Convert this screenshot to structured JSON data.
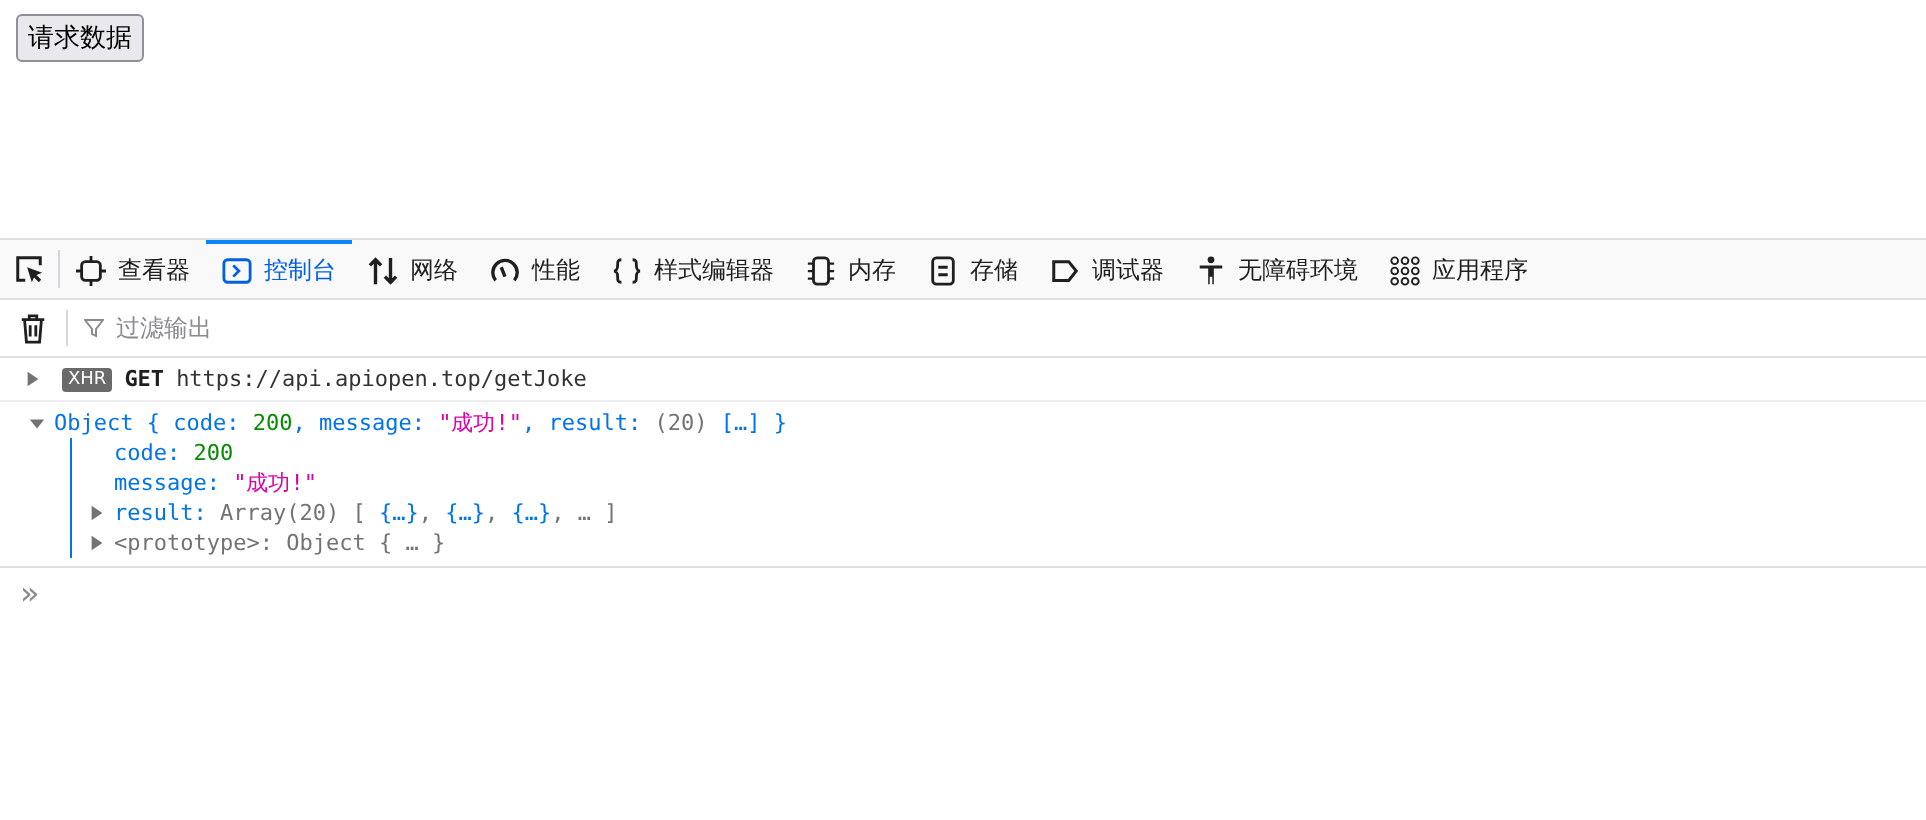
{
  "page": {
    "button": "请求数据"
  },
  "toolbar": {
    "tabs": [
      {
        "kind": "inspector",
        "label": "查看器",
        "selected": false
      },
      {
        "kind": "console",
        "label": "控制台",
        "selected": true
      },
      {
        "kind": "network",
        "label": "网络",
        "selected": false
      },
      {
        "kind": "performance",
        "label": "性能",
        "selected": false
      },
      {
        "kind": "style",
        "label": "样式编辑器",
        "selected": false
      },
      {
        "kind": "memory",
        "label": "内存",
        "selected": false
      },
      {
        "kind": "storage",
        "label": "存储",
        "selected": false
      },
      {
        "kind": "debugger",
        "label": "调试器",
        "selected": false
      },
      {
        "kind": "accessibility",
        "label": "无障碍环境",
        "selected": false
      },
      {
        "kind": "apps",
        "label": "应用程序",
        "selected": false
      }
    ]
  },
  "filter": {
    "placeholder": "过滤输出"
  },
  "console": {
    "request": {
      "expanded": false,
      "badge": "XHR",
      "method": "GET",
      "url": "https://api.apiopen.top/getJoke"
    },
    "object": {
      "expanded": true,
      "summary": [
        {
          "kind": "label",
          "text": "Object { "
        },
        {
          "kind": "key",
          "text": "code: "
        },
        {
          "kind": "number",
          "text": "200"
        },
        {
          "kind": "label",
          "text": ", "
        },
        {
          "kind": "key",
          "text": "message: "
        },
        {
          "kind": "string",
          "text": "\"成功!\""
        },
        {
          "kind": "label",
          "text": ", "
        },
        {
          "kind": "key",
          "text": "result: "
        },
        {
          "kind": "grey",
          "text": "(20) "
        },
        {
          "kind": "label",
          "text": "[…] }"
        }
      ],
      "properties": [
        {
          "kind": "leaf",
          "tokens": [
            {
              "kind": "key",
              "text": "code: "
            },
            {
              "kind": "number",
              "text": "200"
            }
          ]
        },
        {
          "kind": "leaf",
          "tokens": [
            {
              "kind": "key",
              "text": "message: "
            },
            {
              "kind": "string",
              "text": "\"成功!\""
            }
          ]
        },
        {
          "kind": "node",
          "expanded": false,
          "tokens": [
            {
              "kind": "key",
              "text": "result: "
            },
            {
              "kind": "grey",
              "text": "Array(20) [ "
            },
            {
              "kind": "label",
              "text": "{…}"
            },
            {
              "kind": "grey",
              "text": ", "
            },
            {
              "kind": "label",
              "text": "{…}"
            },
            {
              "kind": "grey",
              "text": ", "
            },
            {
              "kind": "label",
              "text": "{…}"
            },
            {
              "kind": "grey",
              "text": ", … ]"
            }
          ]
        },
        {
          "kind": "node",
          "expanded": false,
          "tokens": [
            {
              "kind": "grey",
              "text": "<prototype>: Object { … }"
            }
          ]
        }
      ]
    },
    "prompt": "»"
  }
}
